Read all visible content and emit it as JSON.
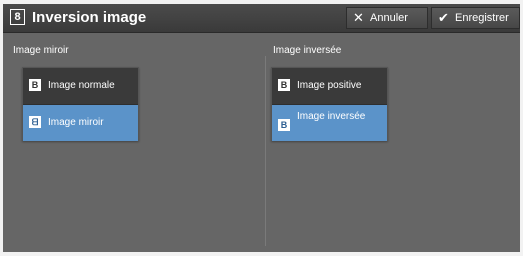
{
  "header": {
    "icon_glyph": "8",
    "title": "Inversion image",
    "cancel_label": "Annuler",
    "save_label": "Enregistrer"
  },
  "left_section": {
    "label": "Image miroir",
    "options": [
      {
        "label": "Image normale",
        "icon_glyph": "B",
        "selected": false
      },
      {
        "label": "Image miroir",
        "icon_glyph": "ᗺ",
        "selected": true
      }
    ]
  },
  "right_section": {
    "label": "Image inversée",
    "options": [
      {
        "label": "Image positive",
        "icon_glyph": "B",
        "selected": false
      },
      {
        "label": "Image inversée",
        "icon_glyph": "B",
        "selected": true
      }
    ]
  },
  "colors": {
    "background": "#666666",
    "header": "#3a3a3a",
    "selected": "#5b93c9",
    "unselected": "#3a3a3a"
  }
}
